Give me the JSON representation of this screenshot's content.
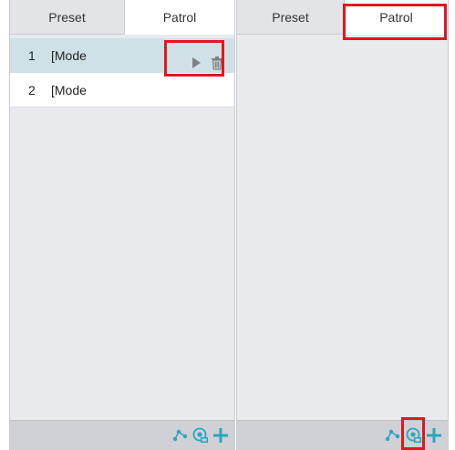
{
  "left_panel": {
    "tabs": [
      {
        "label": "Preset",
        "active": false
      },
      {
        "label": "Patrol",
        "active": true
      }
    ],
    "rows": [
      {
        "num": "1",
        "name": "[Mode",
        "selected": true
      },
      {
        "num": "2",
        "name": "[Mode",
        "selected": false
      }
    ],
    "row_action_icons": [
      "play-icon",
      "trash-icon"
    ],
    "footer_icons": [
      "path-icon",
      "record-icon",
      "add-icon"
    ]
  },
  "right_panel": {
    "tabs": [
      {
        "label": "Preset",
        "active": false
      },
      {
        "label": "Patrol",
        "active": true
      }
    ],
    "footer_icons": [
      "path-icon",
      "record-icon",
      "add-icon"
    ]
  },
  "colors": {
    "accent": "#2aa6c0",
    "highlight": "#e4161b",
    "selected_row": "#cfe1e7",
    "panel_bg": "#e9eaee",
    "footer_bg": "#cfd1d6"
  }
}
